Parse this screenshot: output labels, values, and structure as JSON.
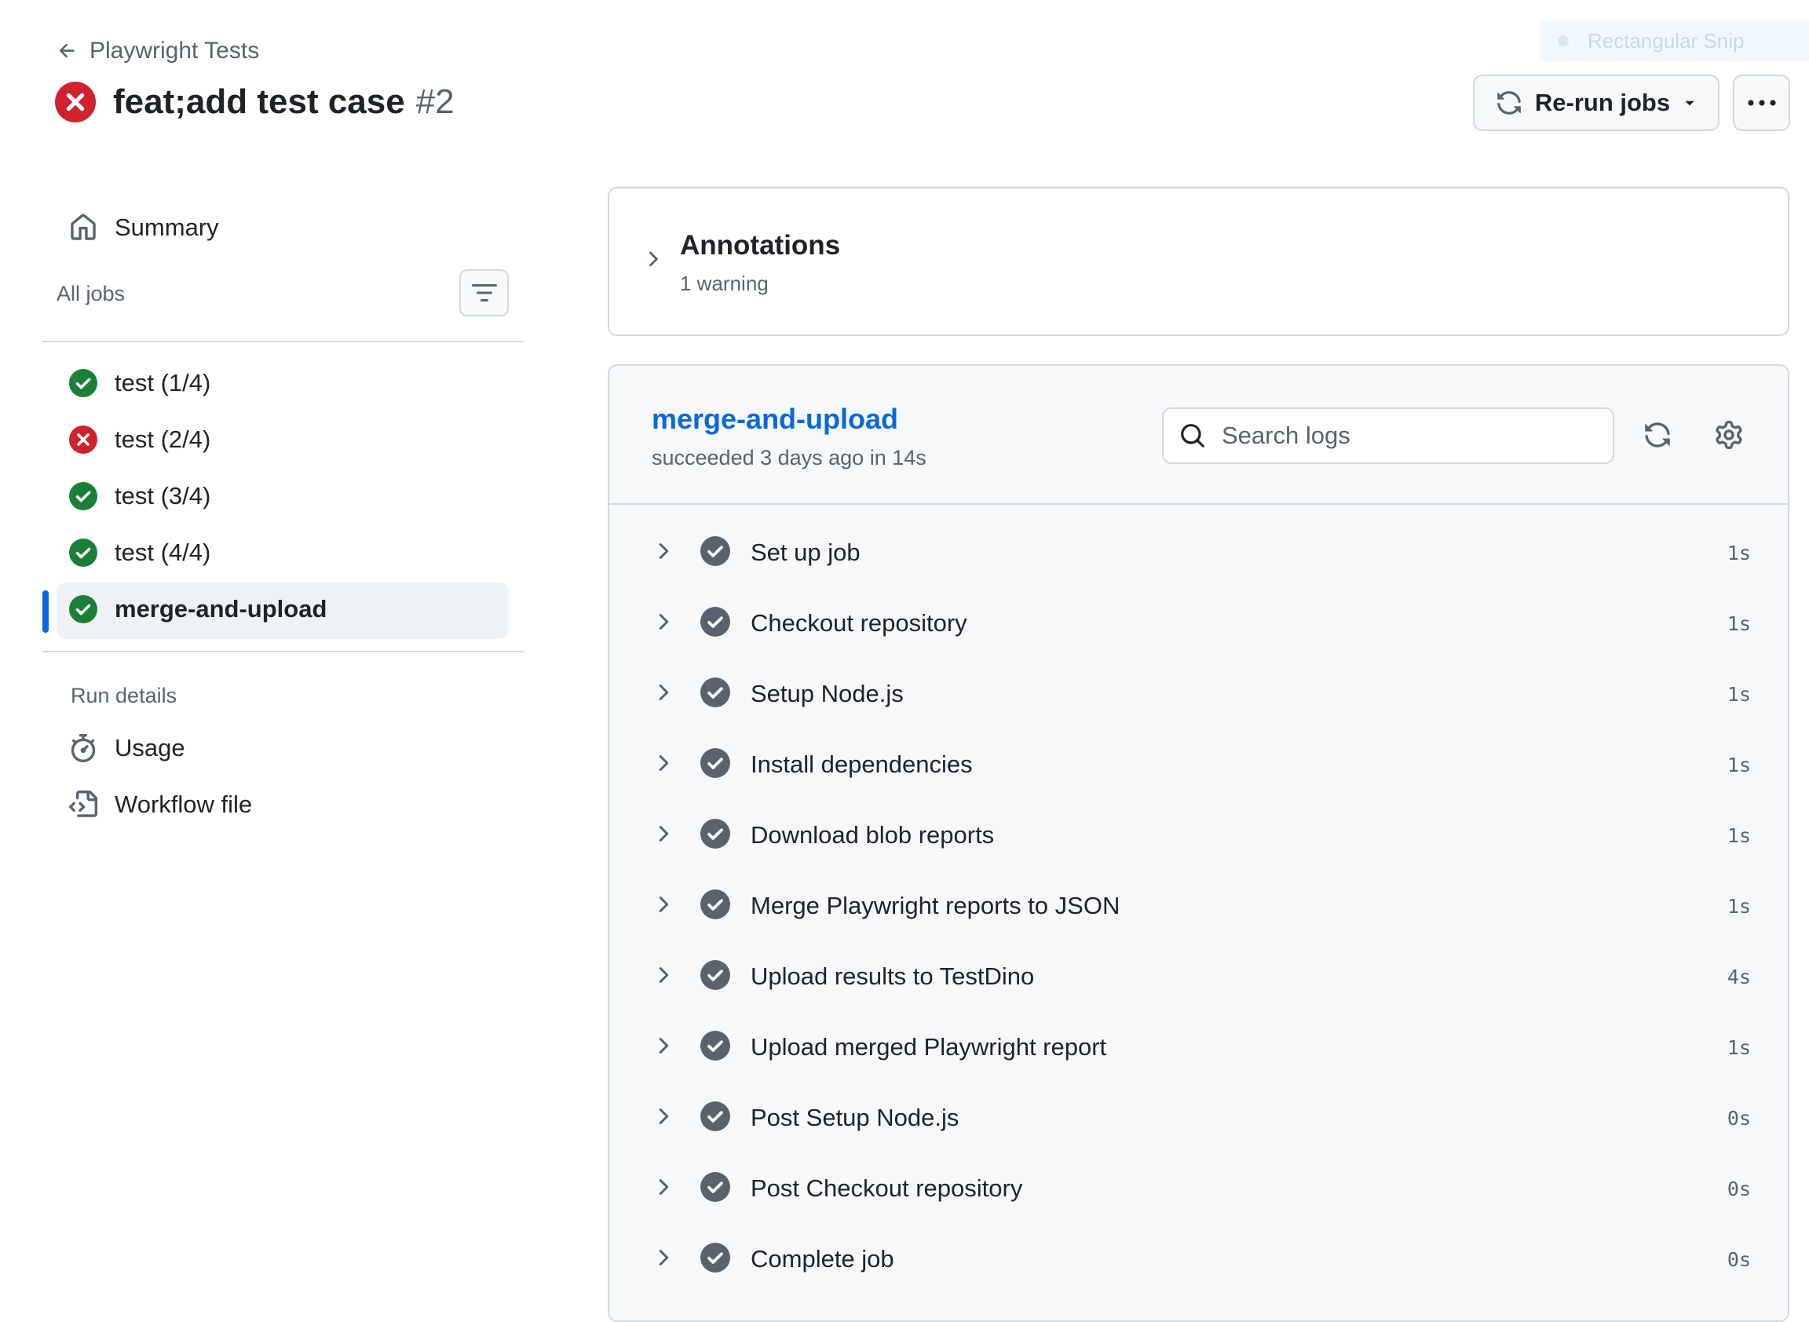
{
  "header": {
    "back_label": "Playwright Tests",
    "run_title": "feat;add test case",
    "run_number": "#2",
    "rerun_label": "Re-run jobs"
  },
  "overlay": {
    "snip_label": "Rectangular Snip"
  },
  "sidebar": {
    "summary_label": "Summary",
    "all_jobs_label": "All jobs",
    "jobs": [
      {
        "label": "test (1/4)",
        "status": "success"
      },
      {
        "label": "test (2/4)",
        "status": "failure"
      },
      {
        "label": "test (3/4)",
        "status": "success"
      },
      {
        "label": "test (4/4)",
        "status": "success"
      },
      {
        "label": "merge-and-upload",
        "status": "success",
        "active": true
      }
    ],
    "run_details_label": "Run details",
    "usage_label": "Usage",
    "workflow_file_label": "Workflow file"
  },
  "annotations": {
    "title": "Annotations",
    "subtitle": "1 warning"
  },
  "job": {
    "name": "merge-and-upload",
    "status_line": "succeeded 3 days ago in 14s",
    "search_placeholder": "Search logs",
    "steps": [
      {
        "name": "Set up job",
        "duration": "1s"
      },
      {
        "name": "Checkout repository",
        "duration": "1s"
      },
      {
        "name": "Setup Node.js",
        "duration": "1s"
      },
      {
        "name": "Install dependencies",
        "duration": "1s"
      },
      {
        "name": "Download blob reports",
        "duration": "1s"
      },
      {
        "name": "Merge Playwright reports to JSON",
        "duration": "1s"
      },
      {
        "name": "Upload results to TestDino",
        "duration": "4s"
      },
      {
        "name": "Upload merged Playwright report",
        "duration": "1s"
      },
      {
        "name": "Post Setup Node.js",
        "duration": "0s"
      },
      {
        "name": "Post Checkout repository",
        "duration": "0s"
      },
      {
        "name": "Complete job",
        "duration": "0s"
      }
    ]
  },
  "colors": {
    "accent": "#0969da",
    "success": "#1a7f37",
    "failure": "#cf222e",
    "step_check": "#59636e"
  }
}
